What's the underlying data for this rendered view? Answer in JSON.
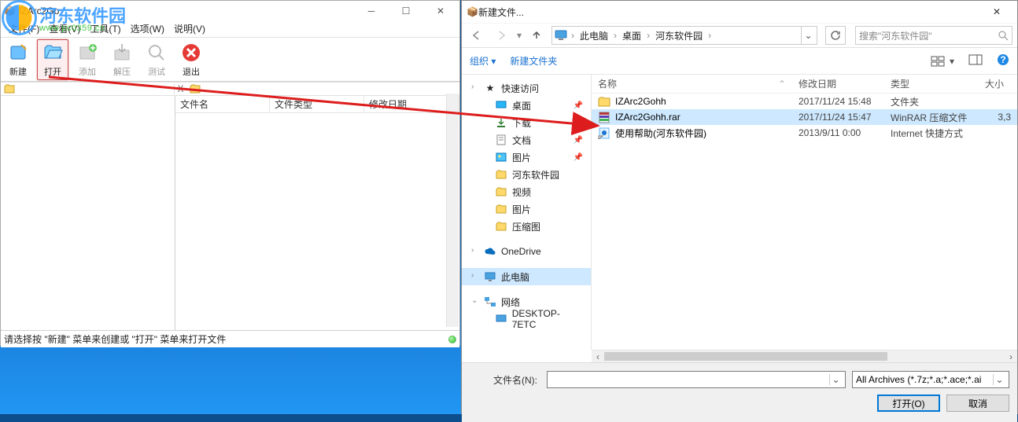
{
  "izarc": {
    "title": "IZArc2Go",
    "menu": [
      "文件(F)",
      "查看(V)",
      "工具(T)",
      "选项(W)",
      "说明(V)"
    ],
    "toolbar": {
      "new": "新建",
      "open": "打开",
      "add": "添加",
      "extract": "解压",
      "test": "测试",
      "exit": "退出"
    },
    "close_x": "X",
    "columns": {
      "name": "文件名",
      "type": "文件类型",
      "modified": "修改日期"
    },
    "status": "请选择按 \"新建\" 菜单来创建或 \"打开\" 菜单来打开文件"
  },
  "watermark": {
    "site": "河东软件园",
    "url": "www.pc0359.cn"
  },
  "dialog": {
    "title": "新建文件...",
    "breadcrumb": [
      "此电脑",
      "桌面",
      "河东软件园"
    ],
    "search_placeholder": "搜索\"河东软件园\"",
    "toolbar": {
      "organize": "组织",
      "newfolder": "新建文件夹"
    },
    "sidebar": {
      "quick": "快速访问",
      "desktop": "桌面",
      "downloads": "下载",
      "documents": "文档",
      "pictures": "图片",
      "hedong": "河东软件园",
      "video": "视频",
      "pictures2": "图片",
      "zipimg": "压缩图",
      "onedrive": "OneDrive",
      "thispc": "此电脑",
      "network": "网络",
      "netnode": "DESKTOP-7ETC"
    },
    "headers": {
      "name": "名称",
      "modified": "修改日期",
      "type": "类型",
      "size": "大小"
    },
    "files": [
      {
        "name": "IZArc2Gohh",
        "modified": "2017/11/24 15:48",
        "type": "文件夹",
        "size": ""
      },
      {
        "name": "IZArc2Gohh.rar",
        "modified": "2017/11/24 15:47",
        "type": "WinRAR 压缩文件",
        "size": "3,3"
      },
      {
        "name": "使用帮助(河东软件园)",
        "modified": "2013/9/11 0:00",
        "type": "Internet 快捷方式",
        "size": ""
      }
    ],
    "filename_label": "文件名(N):",
    "filename_value": "",
    "filter": "All Archives (*.7z;*.a;*.ace;*.ai",
    "btn_open": "打开(O)",
    "btn_cancel": "取消"
  }
}
